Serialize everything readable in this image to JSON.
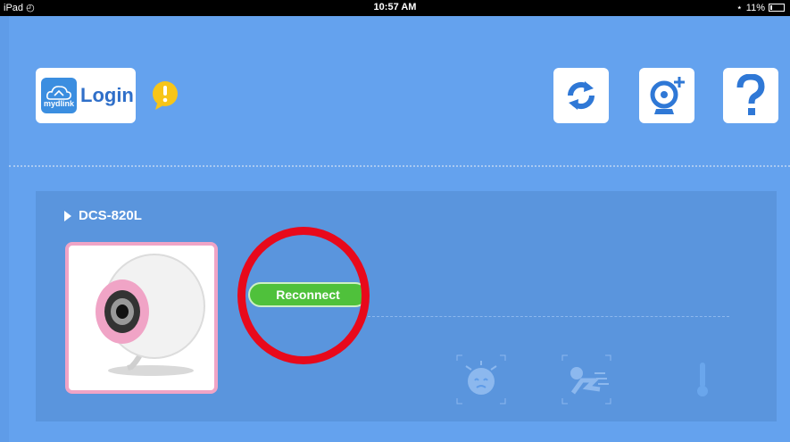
{
  "status_bar": {
    "device": "iPad",
    "time": "10:57 AM",
    "battery": "11%"
  },
  "header": {
    "login_logo_text": "mydlink",
    "login_label": "Login"
  },
  "camera": {
    "name": "DCS-820L",
    "reconnect_label": "Reconnect"
  },
  "colors": {
    "background": "#64a2ee",
    "panel": "#5a95dd",
    "accent_green": "#4fc13b",
    "highlight_red": "#e8091b"
  }
}
